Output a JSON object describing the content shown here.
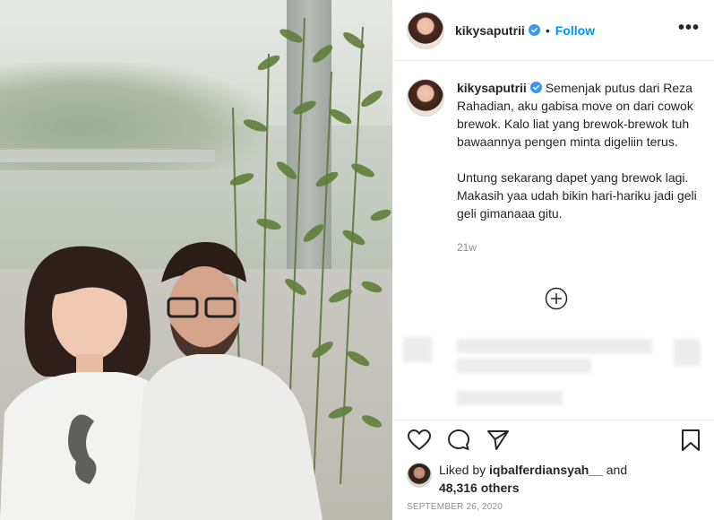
{
  "post": {
    "username": "kikysaputrii",
    "follow_label": "Follow",
    "separator": "•",
    "more_label": "•••",
    "caption": {
      "username": "kikysaputrii",
      "paragraph_1": "Semenjak putus dari Reza Rahadian, aku gabisa move on dari cowok brewok. Kalo liat yang brewok-brewok tuh bawaannya pengen minta digeliin terus.",
      "paragraph_2": "Untung sekarang dapet yang brewok lagi. Makasih yaa udah bikin hari-hariku jadi geli geli gimanaaa gitu.",
      "time_ago": "21w"
    },
    "likes": {
      "prefix": "Liked by ",
      "liker": "iqbalferdiansyah__",
      "conjunction": " and",
      "others": "48,316 others"
    },
    "date": "SEPTEMBER 26, 2020"
  },
  "icons": {
    "verified": "verified-badge-icon",
    "like": "heart-icon",
    "comment": "comment-icon",
    "share": "paper-plane-icon",
    "save": "bookmark-icon",
    "load_more": "plus-circle-icon"
  },
  "colors": {
    "follow": "#0095f6",
    "verified": "#3897f0",
    "text": "#262626",
    "muted": "#8e8e8e"
  }
}
